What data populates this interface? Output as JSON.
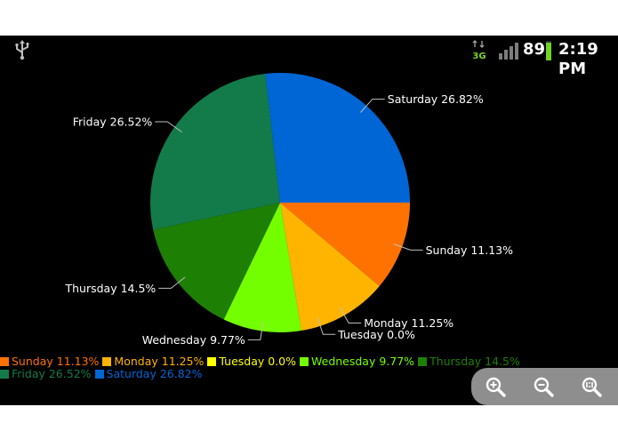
{
  "status_bar": {
    "network_label": "3G",
    "battery_percent": "89",
    "time": "2:19 PM"
  },
  "chart_data": {
    "type": "pie",
    "labels": [
      "Sunday 11.13%",
      "Monday 11.25%",
      "Tuesday 0.0%",
      "Wednesday 9.77%",
      "Thursday 14.5%",
      "Friday 26.52%",
      "Saturday 26.82%"
    ],
    "values": [
      11.13,
      11.25,
      0.0,
      9.77,
      14.5,
      26.52,
      26.82
    ],
    "colors": [
      "#ff7200",
      "#ffb400",
      "#ffff00",
      "#74ff00",
      "#1e7f05",
      "#137b4a",
      "#0066d6"
    ],
    "legend_position": "bottom-left"
  },
  "legend": {
    "items": [
      {
        "label": "Sunday 11.13%",
        "color": "#ff7200"
      },
      {
        "label": "Monday 11.25%",
        "color": "#ffb400"
      },
      {
        "label": "Tuesday 0.0%",
        "color": "#ffff00"
      },
      {
        "label": "Wednesday 9.77%",
        "color": "#74ff00"
      },
      {
        "label": "Thursday 14.5%",
        "color": "#1e7f05"
      },
      {
        "label": "Friday 26.52%",
        "color": "#137b4a"
      },
      {
        "label": "Saturday 26.82%",
        "color": "#0066d6"
      }
    ]
  },
  "zoom_controls": {
    "icons": [
      "zoom-in-icon",
      "zoom-out-icon",
      "zoom-reset-icon"
    ]
  }
}
